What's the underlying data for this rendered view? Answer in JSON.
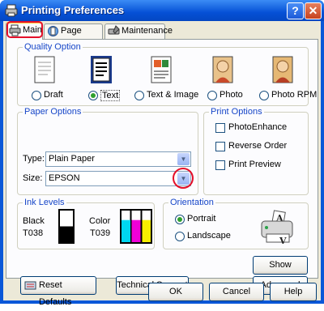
{
  "window": {
    "title": "Printing Preferences"
  },
  "tabs": [
    {
      "label": "Main"
    },
    {
      "label": "Page Layout"
    },
    {
      "label": "Maintenance"
    }
  ],
  "quality_option": {
    "title": "Quality Option",
    "options": [
      {
        "label": "Draft",
        "selected": false
      },
      {
        "label": "Text",
        "selected": true
      },
      {
        "label": "Text & Image",
        "selected": false
      },
      {
        "label": "Photo",
        "selected": false
      },
      {
        "label": "Photo RPM",
        "selected": false
      }
    ]
  },
  "paper_options": {
    "title": "Paper Options",
    "type_label": "Type:",
    "type_value": "Plain Paper",
    "size_label": "Size:",
    "size_value": "EPSON"
  },
  "print_options": {
    "title": "Print Options",
    "items": [
      {
        "label": "PhotoEnhance",
        "checked": false
      },
      {
        "label": "Reverse Order",
        "checked": false
      },
      {
        "label": "Print Preview",
        "checked": false
      }
    ]
  },
  "ink_levels": {
    "title": "Ink Levels",
    "black_label": "Black",
    "black_code": "T038",
    "color_label": "Color",
    "color_code": "T039",
    "black_level": 0.5,
    "color_levels": {
      "cyan": 0.7,
      "magenta": 0.7,
      "yellow": 0.7
    }
  },
  "orientation": {
    "title": "Orientation",
    "portrait": "Portrait",
    "landscape": "Landscape",
    "selected": "Portrait"
  },
  "buttons": {
    "show_settings": "Show Settings",
    "advanced": "Advanced",
    "reset_defaults": "Reset Defaults",
    "technical_support": "Technical Support",
    "ok": "OK",
    "cancel": "Cancel",
    "help": "Help"
  },
  "colors": {
    "title_bar": "#0550d6",
    "accent_red": "#e5102a",
    "group_title": "#1646c8",
    "face": "#ece9d8"
  }
}
